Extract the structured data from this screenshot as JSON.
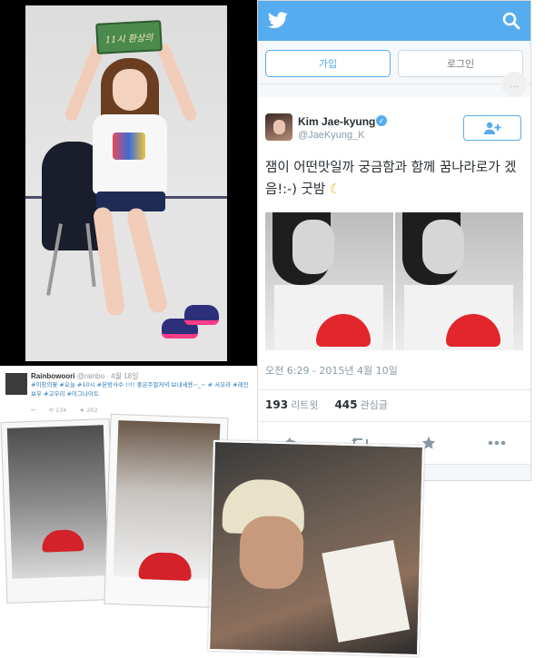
{
  "photo_panel": {
    "sign_text": "11시 환상의"
  },
  "twitter": {
    "brand_color": "#55acee",
    "signup_label": "가입",
    "login_label": "로그인",
    "more_label": "...",
    "tweet": {
      "name": "Kim Jae-kyung",
      "handle": "@JaeKyung_K",
      "text": "잼이 어떤맛일까 궁금함과 함께 꿈나라로가 겠음!:-) 굿밤",
      "moon": "☾",
      "date": "오전 6:29 - 2015년 4월 10일",
      "retweets_count": "193",
      "retweets_label": "리트윗",
      "likes_count": "445",
      "likes_label": "관심글"
    },
    "actions": {
      "reply_icon": "reply-icon",
      "retweet_icon": "retweet-icon",
      "favorite_icon": "star-icon",
      "more_icon": "more-icon"
    }
  },
  "mini_tweet": {
    "name": "Rainbowoori",
    "meta": "@rainbo · 4월 18일",
    "body": "#이창의꽃 #오늘 #10시 #본방사수 !!!! 좋은주말저녁 보내세용~_~ # 서유라 #레인보우 #고우리 #이그나이트",
    "reply": "↩",
    "retweet_count": "134",
    "fav_count": "202"
  }
}
